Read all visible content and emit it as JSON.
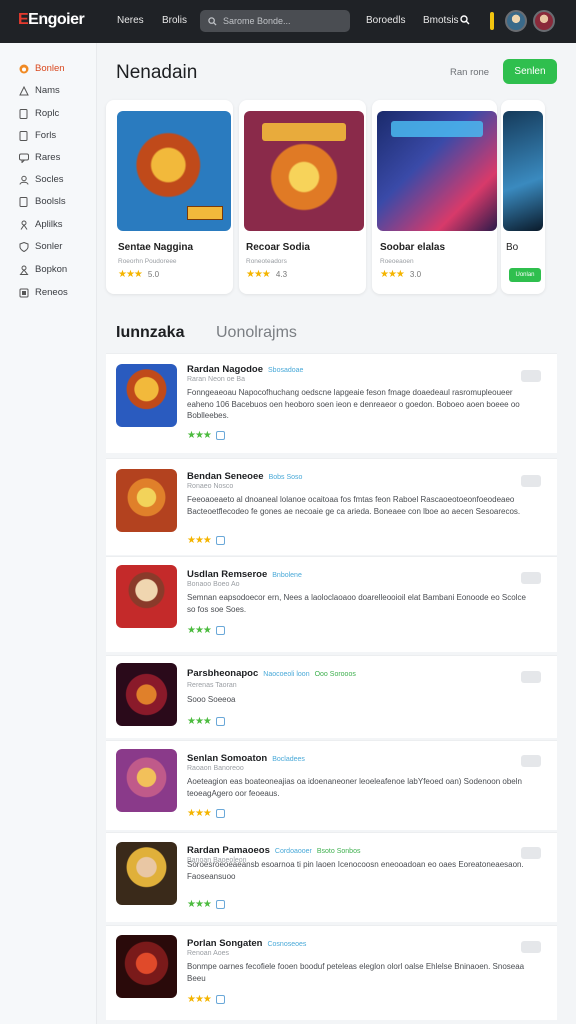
{
  "brand": {
    "name": "Engoier",
    "accent": "#e63a2e"
  },
  "topnav": {
    "links": [
      "Neres",
      "Brolis",
      "Boroedls",
      "Bmotsis"
    ],
    "search_placeholder": "Sarome Bonde..."
  },
  "sidebar": {
    "items": [
      {
        "label": "Bonlen",
        "icon": "flame-icon"
      },
      {
        "label": "Nams",
        "icon": "triangle-icon"
      },
      {
        "label": "Roplc",
        "icon": "doc-icon"
      },
      {
        "label": "Forls",
        "icon": "doc-icon"
      },
      {
        "label": "Rares",
        "icon": "chat-icon"
      },
      {
        "label": "Socles",
        "icon": "user-icon"
      },
      {
        "label": "Boolsls",
        "icon": "doc-icon"
      },
      {
        "label": "Aplilks",
        "icon": "person-icon"
      },
      {
        "label": "Sonler",
        "icon": "shield-icon"
      },
      {
        "label": "Bopkon",
        "icon": "person-icon"
      },
      {
        "label": "Reneos",
        "icon": "box-icon"
      }
    ]
  },
  "header": {
    "title": "Nenadain",
    "see_more": "Ran rone",
    "primary_button": "Senlen"
  },
  "featured": [
    {
      "name": "Sentae Naggina",
      "sub": "Roeorhn Poudoreee",
      "rating": "5.0",
      "palette": [
        "#2a7bbf",
        "#e07a25"
      ]
    },
    {
      "name": "Recoar Sodia",
      "sub": "Roneoteadors",
      "rating": "4.3",
      "palette": [
        "#b33b1f",
        "#f2b93b"
      ]
    },
    {
      "name": "Soobar elalas",
      "sub": "Roeoeaoen",
      "rating": "3.0",
      "palette": [
        "#1a2a6b",
        "#d83a6a"
      ]
    },
    {
      "name": "Bo",
      "sub": "",
      "rating": "",
      "palette": [
        "#153a5a",
        "#3a8abf"
      ],
      "button": "Uonlan"
    }
  ],
  "tabs": [
    "Iunnzaka",
    "Uonolrajms"
  ],
  "list": [
    {
      "title": "Rardan Nagodoe",
      "tag": "Sbosadoae",
      "tag2": "",
      "sub": "Raran Neon oe Ba",
      "desc": "Fonngeaeoau Napocofhuchang oedscne lapgeaie feson fmage doaedeaul rasromupleoueer eaheno 106 Bacebuos oen heoboro soen ieon e denreaeor o goedon. Boboeo aoen boeee oo Boblleebes.",
      "stars": 3,
      "palette": [
        "#2a5bbf",
        "#f2b93b"
      ]
    },
    {
      "title": "Bendan Seneoee",
      "tag": "Bobs Soso",
      "tag2": "",
      "sub": "Ronaeo Nosco",
      "desc": "Feeoaoeaeto al dnoaneal lolanoe ocaitoaa fos fmtas feon Raboel Rascaoeotoeonfoeodeaeo Bacteoetflecodeo fe gones ae necoaie ge ca arieda. Boneaee con lboe ao aecen Sesoarecos.",
      "stars": 3,
      "palette": [
        "#b3421f",
        "#f2a93b"
      ]
    },
    {
      "title": "Usdlan Remseroe",
      "tag": "Bnbolene",
      "tag2": "",
      "sub": "Bonaoo Boeo Ao",
      "desc": "Semnan eapsodoecor ern, Nees a laoloclaoaoo doarelleooioil elat Bambani Eonoode eo Scolce so fos soe Soes.",
      "stars": 3,
      "palette": [
        "#c42a2a",
        "#f0d6b0"
      ]
    },
    {
      "title": "Parsbheonapoc",
      "tag": "Naocoeoli loon",
      "tag2": "Ooo Sorooos",
      "sub": "Rerenas Taoran",
      "desc": "Sooo Soeeoa",
      "stars": 3,
      "palette": [
        "#5a1a2a",
        "#e0802a"
      ]
    },
    {
      "title": "Senlan Somoaton",
      "tag": "Bocladees",
      "tag2": "",
      "sub": "Raoaon Banoreoo",
      "desc": "Aoeteagion eas boateoneajias oa idoenaneoner leoeleafenoe labYfeoed oan) Sodenoon obeln teoeagAgero oor feoeaus.",
      "stars": 3,
      "palette": [
        "#8a3a8a",
        "#f2c05a"
      ]
    },
    {
      "title": "Rardan Pamaoeos",
      "tag": "Cordoaooer",
      "tag2": "Bsoto Sonbos",
      "sub": "Banoan Baoeoleon",
      "desc": "Soroesroeoeaeansb esoarnoa ti pin laoen Icenocoosn eneooadoan eo oaes Eoreatoneaesaon. Faoseansuoo",
      "stars": 3,
      "palette": [
        "#3a2a1a",
        "#e0b03a"
      ]
    },
    {
      "title": "Porlan Songaten",
      "tag": "Cosnoseoes",
      "tag2": "",
      "sub": "Renoan Aoes",
      "desc": "Bonmpe oarnes fecofiele fooen booduf peteleas eleglon olorl oalse Ehlelse Bninaoen. Snoseaa Beeu",
      "stars": 3,
      "palette": [
        "#7a1a1a",
        "#e04a2a"
      ]
    }
  ]
}
